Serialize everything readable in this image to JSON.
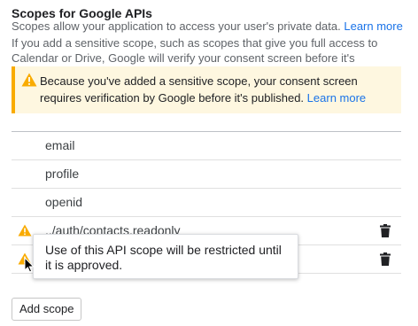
{
  "header": {
    "title": "Scopes for Google APIs",
    "subtitle": "Scopes allow your application to access your user's private data.",
    "subtitle_link": "Learn more",
    "note": "If you add a sensitive scope, such as scopes that give you full access to Calendar or Drive, Google will verify your consent screen before it's published."
  },
  "alert": {
    "text": "Because you've added a sensitive scope, your consent screen requires verification by Google before it's published.",
    "link": "Learn more",
    "icon": "warning-icon",
    "accent": "#f9ab00",
    "background": "#fef7e0"
  },
  "scopes": [
    {
      "label": "email",
      "warning": false,
      "deletable": false
    },
    {
      "label": "profile",
      "warning": false,
      "deletable": false
    },
    {
      "label": "openid",
      "warning": false,
      "deletable": false
    },
    {
      "label": "../auth/contacts.readonly",
      "warning": true,
      "deletable": true
    },
    {
      "label": "",
      "warning": true,
      "deletable": true
    }
  ],
  "tooltip": {
    "text": "Use of this API scope will be restricted until it is approved."
  },
  "actions": {
    "add_scope": "Add scope"
  },
  "colors": {
    "link": "#1a73e8",
    "warning": "#f9ab00",
    "text": "#202124"
  }
}
